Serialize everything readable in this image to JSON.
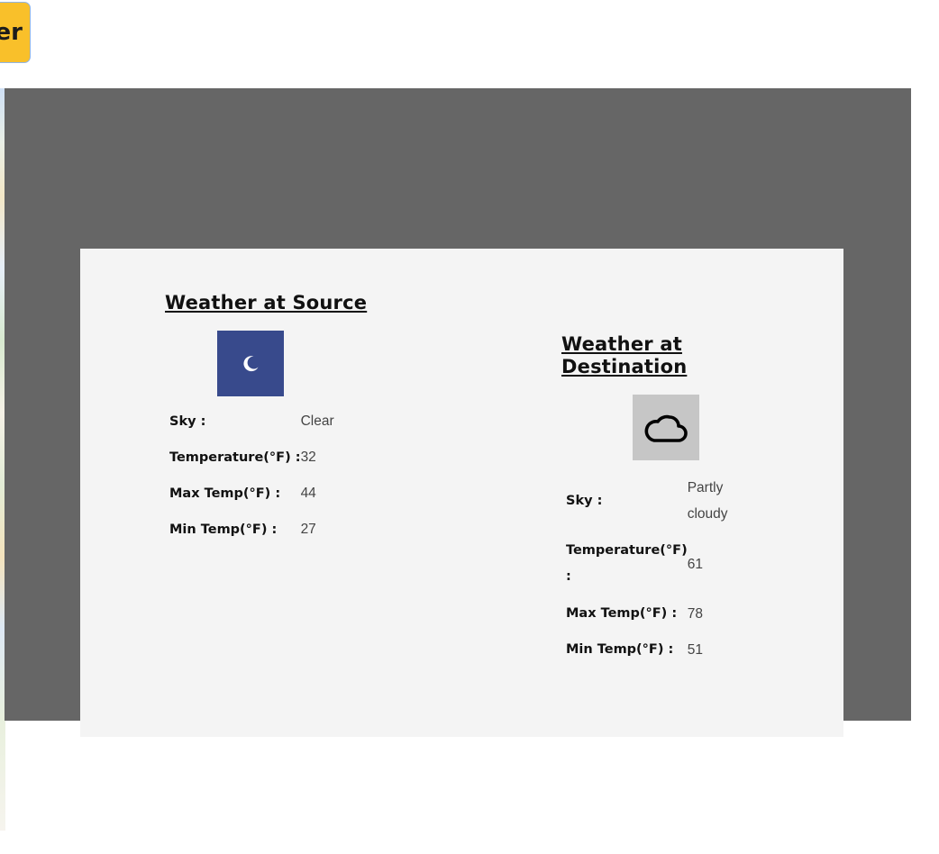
{
  "toolbar": {
    "button_label": "er",
    "button_color": "#f9c02a"
  },
  "modal": {
    "overlay_color": "#666666",
    "panel_color": "#f4f4f4",
    "source": {
      "title": "Weather at Source",
      "icon": "moon-icon",
      "icon_bg": "#384a8c",
      "rows": [
        {
          "label": "Sky :",
          "value": "Clear"
        },
        {
          "label": "Temperature(°F) :",
          "value": "32"
        },
        {
          "label": "Max Temp(°F) :",
          "value": "44"
        },
        {
          "label": "Min Temp(°F) :",
          "value": "27"
        }
      ]
    },
    "destination": {
      "title": "Weather at Destination",
      "icon": "cloud-icon",
      "icon_bg": "#c6c6c6",
      "rows": [
        {
          "label": "Sky :",
          "value": "Partly cloudy"
        },
        {
          "label": "Temperature(°F) :",
          "value": "61"
        },
        {
          "label": "Max Temp(°F) :",
          "value": "78"
        },
        {
          "label": "Min Temp(°F) :",
          "value": "51"
        }
      ]
    }
  }
}
